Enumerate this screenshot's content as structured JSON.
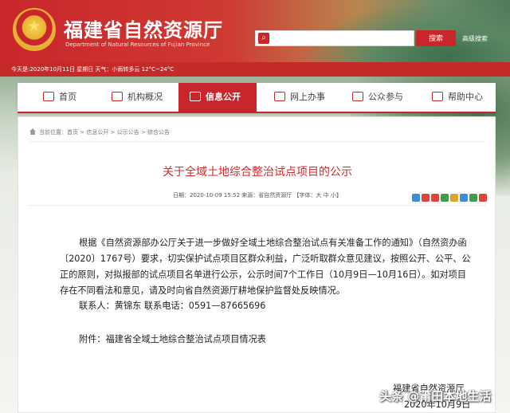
{
  "header": {
    "title": "福建省自然资源厅",
    "subtitle": "Department of Natural Resources of Fujian Province",
    "search_placeholder": "",
    "search_label": "搜索",
    "advanced_search": "高级搜索",
    "brand_color": "#c9262b"
  },
  "infobar": {
    "text": "今天是:2020年10月11日  星期日 天气：小雨转多云 12°C~24°C"
  },
  "nav": [
    {
      "label": "首页",
      "icon": "home-icon",
      "active": false
    },
    {
      "label": "机构概况",
      "icon": "building-icon",
      "active": false
    },
    {
      "label": "信息公开",
      "icon": "document-icon",
      "active": true
    },
    {
      "label": "网上办事",
      "icon": "monitor-icon",
      "active": false
    },
    {
      "label": "公众参与",
      "icon": "people-icon",
      "active": false
    },
    {
      "label": "帮助中心",
      "icon": "help-icon",
      "active": false
    }
  ],
  "breadcrumb": "当前位置：首页 > 信息公开 > 公示公告 > 综合公告",
  "article": {
    "title": "关于全域土地综合整治试点项目的公示",
    "meta": "日期：2020-10-09 15:52  来源：省自然资源厅    【字体：大 中 小】",
    "body": "根据《自然资源部办公厅关于进一步做好全域土地综合整治试点有关准备工作的通知》（自然资办函〔2020〕1767号）要求，切实保护试点项目区群众利益，广泛听取群众意见建议，按照公开、公平、公正的原则，对拟报部的试点项目名单进行公示，公示时间7个工作日（10月9日—10月16日）。如对项目存在不同看法和意见，请及时向省自然资源厅耕地保护监督处反映情况。",
    "contact": "联系人：黄锦东    联系电话：0591—87665696",
    "attachment": "附件：福建省全域土地综合整治试点项目情况表",
    "sign_org": "福建省自然资源厅",
    "sign_date": "2020年10月9日"
  },
  "watermark": "头条 @莆田本地生活",
  "share_colors": [
    "#3b8fd9",
    "#e0463a",
    "#e0463a",
    "#3f9c4a",
    "#d9a62a",
    "#3b8fd9",
    "#3f9c4a",
    "#e0463a"
  ]
}
